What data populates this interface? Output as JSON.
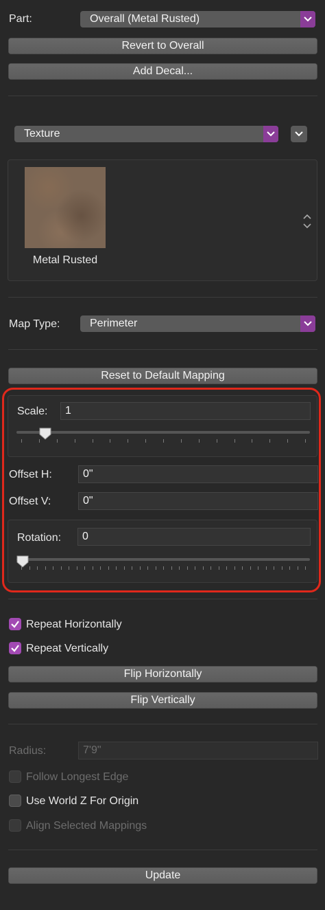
{
  "part": {
    "label": "Part:",
    "value": "Overall (Metal Rusted)"
  },
  "buttons": {
    "revert": "Revert to Overall",
    "add_decal": "Add Decal...",
    "reset_mapping": "Reset to Default Mapping",
    "flip_h": "Flip Horizontally",
    "flip_v": "Flip Vertically",
    "update": "Update"
  },
  "texture": {
    "mode": "Texture",
    "swatch_name": "Metal Rusted"
  },
  "map_type": {
    "label": "Map Type:",
    "value": "Perimeter"
  },
  "scale": {
    "label": "Scale:",
    "value": "1",
    "slider_fraction": 0.08
  },
  "offset_h": {
    "label": "Offset H:",
    "value": "0\""
  },
  "offset_v": {
    "label": "Offset V:",
    "value": "0\""
  },
  "rotation": {
    "label": "Rotation:",
    "value": "0",
    "slider_fraction": 0.0
  },
  "checkboxes": {
    "repeat_h": {
      "label": "Repeat Horizontally",
      "checked": true
    },
    "repeat_v": {
      "label": "Repeat Vertically",
      "checked": true
    },
    "follow_edge": {
      "label": "Follow Longest Edge",
      "checked": false,
      "disabled": true
    },
    "world_z": {
      "label": "Use World Z For Origin",
      "checked": false
    },
    "align_sel": {
      "label": "Align Selected Mappings",
      "checked": false,
      "disabled": true
    }
  },
  "radius": {
    "label": "Radius:",
    "value": "7'9\""
  },
  "colors": {
    "accent": "#a24ab3",
    "highlight": "#e0281b"
  }
}
